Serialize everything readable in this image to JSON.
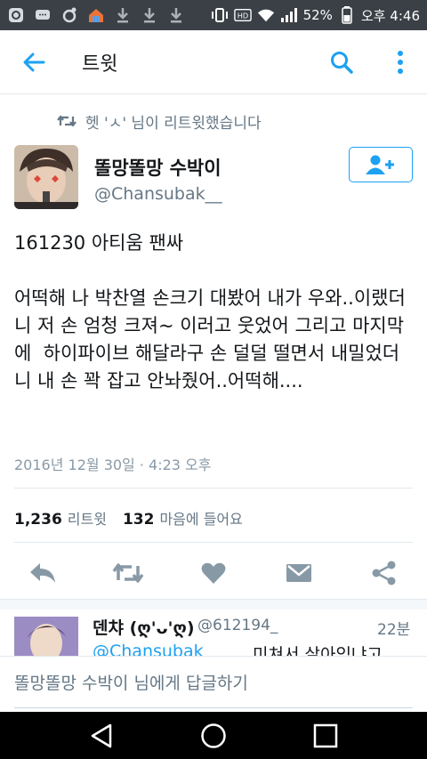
{
  "status_bar": {
    "battery": "52%",
    "clock": "오후 4:46",
    "icons": [
      "app-icon",
      "message-icon",
      "record-icon",
      "home-badge-icon",
      "download-icon",
      "download-icon",
      "download-icon",
      "vibrate-icon",
      "hd-icon",
      "wifi-icon",
      "signal-icon",
      "battery-icon"
    ]
  },
  "app_bar": {
    "title": "트윗"
  },
  "retweet_context": {
    "text": "헷 'ㅅ' 님이 리트윗했습니다"
  },
  "tweet": {
    "author_name": "똘망똘망 수박이",
    "author_handle": "@Chansubak__",
    "body": "161230 아티움 팬싸\n\n어떡해 나 박찬열 손크기 대봤어 내가 우와..이랬더니 저 손 엄청 크져~ 이러고 웃었어 그리고 마지막에  하이파이브 해달라구 손 덜덜 떨면서 내밀었더니 내 손 꽉 잡고 안놔줬어..어떡해....",
    "timestamp": "2016년 12월 30일 · 4:23 오후",
    "retweet_count": "1,236",
    "retweet_label": "리트윗",
    "like_count": "132",
    "like_label": "마음에 들어요"
  },
  "reply_preview": {
    "name": "덴챠 (ღ'ᴗ'ღ)",
    "handle": "@612194_",
    "time": "22분",
    "mention": "@Chansubak__",
    "text": "미쳐서 살아있냐고"
  },
  "compose": {
    "placeholder": "똘망똘망 수박이 님에게 답글하기"
  },
  "colors": {
    "accent": "#1da1f2",
    "icon_gray": "#8899a6",
    "status_bar": "#3b4046",
    "nav_bar": "#000000"
  }
}
